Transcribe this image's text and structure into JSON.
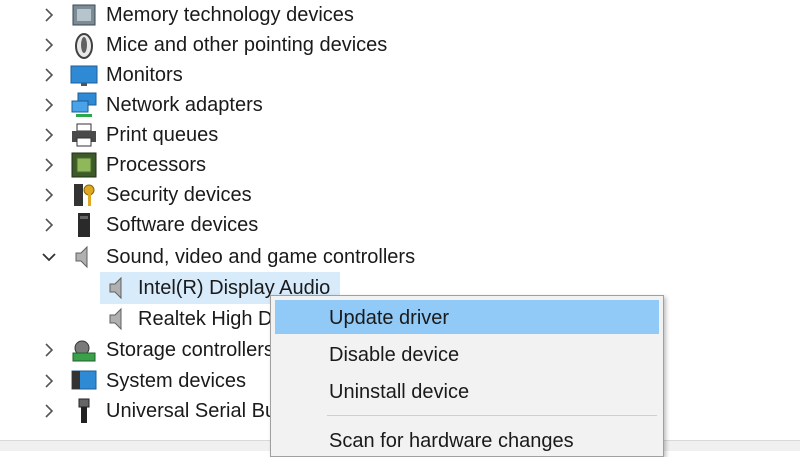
{
  "tree": {
    "items": [
      {
        "label": "Memory technology devices",
        "expanded": false,
        "icon": "memory-chip-icon"
      },
      {
        "label": "Mice and other pointing devices",
        "expanded": false,
        "icon": "mouse-icon"
      },
      {
        "label": "Monitors",
        "expanded": false,
        "icon": "monitor-icon"
      },
      {
        "label": "Network adapters",
        "expanded": false,
        "icon": "network-icon"
      },
      {
        "label": "Print queues",
        "expanded": false,
        "icon": "printer-icon"
      },
      {
        "label": "Processors",
        "expanded": false,
        "icon": "processor-icon"
      },
      {
        "label": "Security devices",
        "expanded": false,
        "icon": "security-key-icon"
      },
      {
        "label": "Software devices",
        "expanded": false,
        "icon": "software-device-icon"
      },
      {
        "label": "Sound, video and game controllers",
        "expanded": true,
        "icon": "speaker-icon"
      },
      {
        "label": "Intel(R) Display Audio",
        "child": true,
        "selected": true,
        "icon": "speaker-icon"
      },
      {
        "label": "Realtek High D",
        "child": true,
        "icon": "speaker-icon"
      },
      {
        "label": "Storage controllers",
        "expanded": false,
        "icon": "storage-icon"
      },
      {
        "label": "System devices",
        "expanded": false,
        "icon": "system-icon"
      },
      {
        "label": "Universal Serial Bu",
        "expanded": false,
        "icon": "usb-icon"
      }
    ]
  },
  "context_menu": {
    "items": [
      {
        "label": "Update driver",
        "highlighted": true
      },
      {
        "label": "Disable device"
      },
      {
        "label": "Uninstall device"
      },
      {
        "label": "Scan for hardware changes"
      }
    ]
  },
  "colors": {
    "selection": "#d8ebfb",
    "menu_highlight": "#91c9f7",
    "menu_background": "#f2f2f2"
  }
}
